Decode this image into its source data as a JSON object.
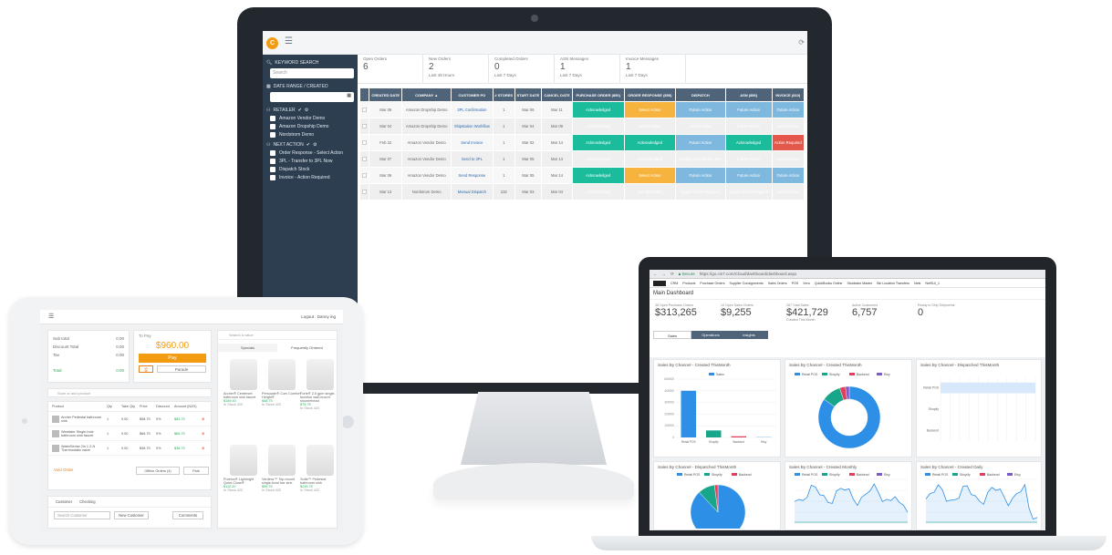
{
  "monitor": {
    "sidebar": {
      "keyword_label": "KEYWORD SEARCH",
      "search_placeholder": "Search",
      "date_label": "DATE RANGE / CREATED",
      "retailer_label": "RETAILER",
      "retailers": [
        "Amazon Vendor Demo",
        "Amazon Dropship Demo",
        "Nordstrom Demo"
      ],
      "next_action_label": "NEXT ACTION",
      "actions": [
        "Order Response - Select Action",
        "3PL - Transfer to 3PL Now",
        "Dispatch Stock",
        "Invoice - Action Required"
      ]
    },
    "stats": [
      {
        "label": "Open Orders",
        "value": "6",
        "sub": ""
      },
      {
        "label": "New Orders",
        "value": "2",
        "sub": "Last 48 Hours"
      },
      {
        "label": "Completed Orders",
        "value": "0",
        "sub": "Last 7 Days"
      },
      {
        "label": "ASN Messages",
        "value": "1",
        "sub": "Last 7 Days"
      },
      {
        "label": "Invoice Messages",
        "value": "1",
        "sub": "Last 7 Days"
      }
    ],
    "table": {
      "headers": [
        "CREATED DATE",
        "COMPANY ▲",
        "CUSTOMER PO",
        "# STORES",
        "START DATE",
        "CANCEL DATE",
        "PURCHASE ORDER (850)",
        "ORDER RESPONSE (855)",
        "DISPATCH",
        "ASN (856)",
        "INVOICE (810)"
      ],
      "rows": [
        [
          "Mar 06",
          "Amazon Dropship Demo",
          "3PL Confirmation",
          "1",
          "Mar 06",
          "Mar 11",
          "Acknowledged",
          "Select Action",
          "Future Action",
          "Future Action",
          "Future Action"
        ],
        [
          "Mar 04",
          "Amazon Dropship Demo",
          "Shipstation Workflow",
          "1",
          "Mar 04",
          "Mar 09",
          "Acknowledged",
          "Select Action",
          "Future Action",
          "Future Action",
          "Future Action"
        ],
        [
          "Feb 22",
          "Amazon Vendor Demo",
          "Send Invoice",
          "1",
          "Mar 02",
          "Mar 14",
          "Acknowledged",
          "Acknowledged",
          "Future Action",
          "Acknowledged",
          "Action Required"
        ],
        [
          "Mar 07",
          "Amazon Vendor Demo",
          "Send to 3PL",
          "1",
          "Mar 05",
          "Mar 14",
          "Acknowledged",
          "Acknowledged",
          "Waiting to be sent to 3PL",
          "Future Action",
          "Future Action"
        ],
        [
          "Mar 06",
          "Amazon Vendor Demo",
          "Send Response",
          "1",
          "Mar 05",
          "Mar 14",
          "Acknowledged",
          "Select Action",
          "Future Action",
          "Future Action",
          "Future Action"
        ],
        [
          "Mar 13",
          "Nordstrom Demo",
          "Manual Dispatch",
          "232",
          "Mar 03",
          "Mar 04",
          "Acknowledged",
          "Not Applicable",
          "Urgent Action Required",
          "Urgent Action Required",
          "Future Action"
        ]
      ]
    }
  },
  "tablet": {
    "logout": "Logout : Danny ing",
    "summary": [
      {
        "label": "Sub total",
        "value": "0.00"
      },
      {
        "label": "Discount Total",
        "value": "0.00"
      },
      {
        "label": "Tax",
        "value": "0.00"
      },
      {
        "label": "Total",
        "value": "0.00"
      }
    ],
    "to_pay_label": "To Pay",
    "to_pay": "$960.00",
    "pay_button": "Pay",
    "parade_button": "Parade",
    "search_product": "Scan or add product",
    "search_value": "Search a value",
    "tabs": [
      "Specials",
      "Frequently Ordered"
    ],
    "line_headers": [
      "Product",
      "Qty",
      "Take Qty",
      "Price",
      "Discount",
      "Amount (NZD)"
    ],
    "lines": [
      {
        "name": "Archer Pedestal bathroom sink",
        "qty": "1",
        "take": "0.00",
        "price": "$58.75",
        "disc": "0%",
        "amount": "$83.75"
      },
      {
        "name": "Westlake Single-hole bathroom sink faucet",
        "qty": "1",
        "take": "0.00",
        "price": "$66.75",
        "disc": "0%",
        "amount": "$66.75"
      },
      {
        "name": "WaterSense 2in 1 2-N Thermostatic valve",
        "qty": "1",
        "take": "0.00",
        "price": "$38.75",
        "disc": "0%",
        "amount": "$38.75"
      }
    ],
    "void_order": "Void Order",
    "offline_button": "Offline Orders (4)",
    "park_button": "Park",
    "customer_tabs": [
      "Customer",
      "Checking"
    ],
    "search_customer": "Search Customer",
    "new_customer": "New Customer",
    "comments": "Comments",
    "products": [
      {
        "name": "Archer® Centerset bathroom sink faucet",
        "price": "$159.40",
        "note": "In Stock 420"
      },
      {
        "name": "Persuade® Curv Comfort Height®",
        "price": "$48.75",
        "note": "In Stock 420"
      },
      {
        "name": "Forte® 2.5 gpm single-function wall-mount showerhead",
        "price": "$75.75",
        "note": "In Stock 420"
      },
      {
        "name": "Purelux® Lightnight Quiet-Close®",
        "price": "$112.20",
        "note": "In Stock 420"
      },
      {
        "name": "Verdera™ Top-mount single-bowl bar sink",
        "price": "$95.75",
        "note": "In Stock 420"
      },
      {
        "name": "Sofia™ Pedestal bathroom sink",
        "price": "$235.75",
        "note": "In Stock 420"
      }
    ]
  },
  "laptop": {
    "url": "https://go.cin7.com/Cloud/dashboard/dashboard.aspx",
    "secure": "Secure",
    "nav": [
      "CRM",
      "Products",
      "Purchase Orders",
      "Supplier Consignments",
      "Sales Orders",
      "POS",
      "Xero",
      "QuickBooks Online",
      "Stocktake Master",
      "Bin Location Transfers",
      "Nets",
      "NetSUI_1"
    ],
    "title": "Main Dashboard",
    "stats": [
      {
        "label": "38 Open Purchase Orders",
        "value": "$313,265"
      },
      {
        "label": "10 Open Sales Orders",
        "value": "$9,255"
      },
      {
        "label": "267 Total Sales",
        "value": "$421,729",
        "sub": "Created This Month"
      },
      {
        "label": "Active Customers",
        "value": "6,757"
      },
      {
        "label": "Ready to Ship Shipments",
        "value": "0"
      }
    ],
    "tabs": [
      "Sales",
      "Operations",
      "Insights"
    ],
    "panels": [
      "Sales By Channel - Created ThisMonth",
      "Sales By Channel - Created ThisMonth",
      "Sales By Channel - Dispatched ThisMonth",
      "Sales By Channel - Dispatched ThisMonth",
      "Sales By Channel - Created Monthly",
      "Sales By Channel - Created Daily"
    ],
    "legend": [
      "Retail POS",
      "Shopify",
      "Backend",
      "Etsy"
    ],
    "colors": {
      "blue": "#2d8fe5",
      "green": "#17a689",
      "red": "#e0405c",
      "purple": "#7d5ac9"
    }
  },
  "chart_data": [
    {
      "type": "bar",
      "categories": [
        "Retail POS",
        "Shopify",
        "Backend",
        "Etsy"
      ],
      "values": [
        400000,
        60000,
        10000,
        2000
      ],
      "ylim": [
        0,
        500000
      ],
      "legend": [
        "Sales"
      ]
    },
    {
      "type": "pie",
      "categories": [
        "Retail POS",
        "Shopify",
        "Backend",
        "Etsy"
      ],
      "values": [
        85,
        10,
        3,
        2
      ]
    },
    {
      "type": "bar",
      "categories": [
        "Retail POS",
        "Shopify",
        "Backend"
      ],
      "values": [
        1,
        0,
        0
      ]
    },
    {
      "type": "pie",
      "categories": [
        "Retail POS",
        "Shopify",
        "Backend"
      ],
      "values": [
        88,
        10,
        2
      ]
    }
  ]
}
